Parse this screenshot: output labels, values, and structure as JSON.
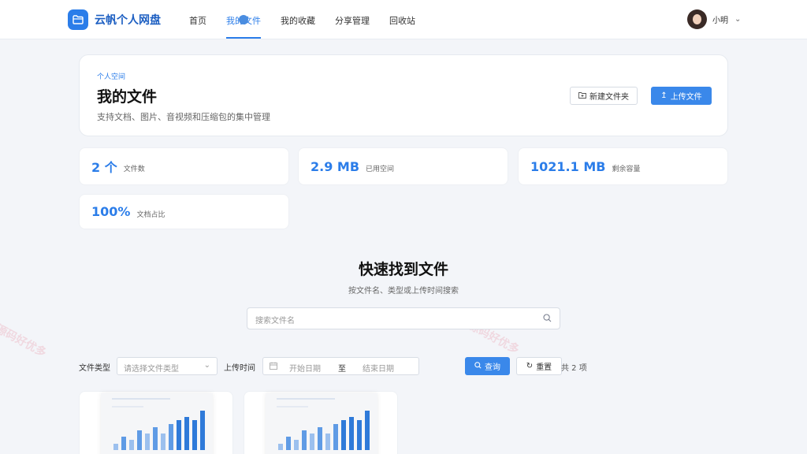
{
  "brand": {
    "name": "云帆个人网盘"
  },
  "nav": {
    "items": [
      "首页",
      "我的文件",
      "我的收藏",
      "分享管理",
      "回收站"
    ],
    "active_index": 1
  },
  "user": {
    "name": "小明"
  },
  "hero": {
    "tag": "个人空间",
    "title": "我的文件",
    "desc": "支持文档、图片、音视频和压缩包的集中管理",
    "new_folder_label": "新建文件夹",
    "upload_label": "上传文件"
  },
  "stats": [
    {
      "value": "2 个",
      "label": "文件数"
    },
    {
      "value": "2.9 MB",
      "label": "已用空间"
    },
    {
      "value": "1021.1 MB",
      "label": "剩余容量"
    },
    {
      "value": "100%",
      "label": "文档占比"
    }
  ],
  "search": {
    "title": "快速找到文件",
    "subtitle": "按文件名、类型或上传时间搜索",
    "placeholder": "搜索文件名"
  },
  "filters": {
    "type_label": "文件类型",
    "type_placeholder": "请选择文件类型",
    "time_label": "上传时间",
    "start_placeholder": "开始日期",
    "separator": "至",
    "end_placeholder": "结束日期",
    "query_label": "查询",
    "reset_label": "重置",
    "total": "共 2 项"
  },
  "thumbnail_chart": {
    "values": [
      2,
      4,
      3,
      6,
      5,
      7,
      5,
      8,
      9,
      10,
      9,
      12
    ]
  },
  "watermark": "源码好优多",
  "colors": {
    "accent": "#2b7de9",
    "primary_button": "#3a88ea"
  }
}
